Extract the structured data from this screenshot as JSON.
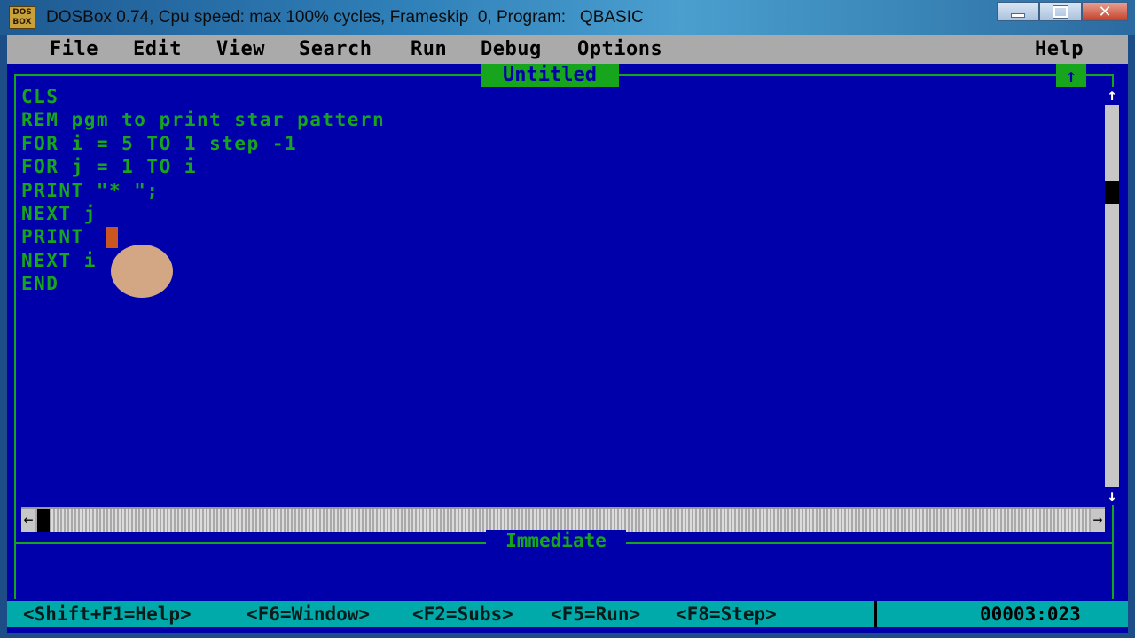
{
  "window": {
    "app_icon_text": "DOS BOX",
    "title": "DOSBox 0.74, Cpu speed: max 100% cycles, Frameskip  0, Program:   QBASIC"
  },
  "menu": {
    "items": [
      "File",
      "Edit",
      "View",
      "Search",
      "Run",
      "Debug",
      "Options"
    ],
    "help": "Help"
  },
  "editor": {
    "title": "Untitled",
    "maximize_glyph": "↑",
    "lines": [
      "CLS",
      "REM pgm to print star pattern",
      "FOR i = 5 TO 1 step -1",
      "FOR j = 1 TO i",
      "PRINT \"* \";",
      "NEXT j",
      "PRINT",
      "NEXT i",
      "END"
    ]
  },
  "scrollbars": {
    "up_arrow": "↑",
    "down_arrow": "↓",
    "left_arrow": "←",
    "right_arrow": "→"
  },
  "immediate": {
    "title": "Immediate"
  },
  "status": {
    "hints": [
      "<Shift+F1=Help>",
      "<F6=Window>",
      "<F2=Subs>",
      "<F5=Run>",
      "<F8=Step>"
    ],
    "position": "00003:023"
  },
  "colors": {
    "dos_blue": "#0000aa",
    "text_green": "#17a51e",
    "menu_gray": "#aaaaaa",
    "status_cyan": "#00aaaa",
    "cursor_orange": "#c8561e"
  }
}
